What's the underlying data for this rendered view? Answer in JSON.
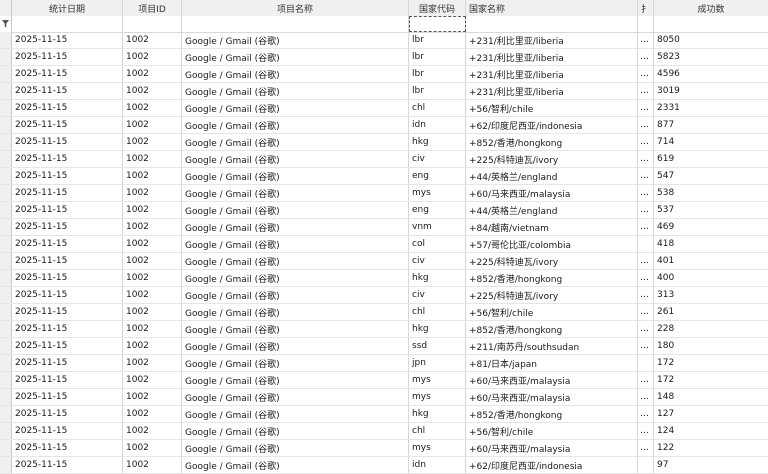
{
  "columns": [
    "统计日期",
    "项目ID",
    "项目名称",
    "国家代码",
    "国家名称",
    "扌",
    "成功数"
  ],
  "filter_icon": "funnel-icon",
  "rows": [
    [
      "2025-11-15",
      "1002",
      "Google / Gmail (谷歌)",
      "lbr",
      "+231/利比里亚/liberia",
      "…",
      "8050"
    ],
    [
      "2025-11-15",
      "1002",
      "Google / Gmail (谷歌)",
      "lbr",
      "+231/利比里亚/liberia",
      "…",
      "5823"
    ],
    [
      "2025-11-15",
      "1002",
      "Google / Gmail (谷歌)",
      "lbr",
      "+231/利比里亚/liberia",
      "…",
      "4596"
    ],
    [
      "2025-11-15",
      "1002",
      "Google / Gmail (谷歌)",
      "lbr",
      "+231/利比里亚/liberia",
      "…",
      "3019"
    ],
    [
      "2025-11-15",
      "1002",
      "Google / Gmail (谷歌)",
      "chl",
      "+56/智利/chile",
      "…",
      "2331"
    ],
    [
      "2025-11-15",
      "1002",
      "Google / Gmail (谷歌)",
      "idn",
      "+62/印度尼西亚/indonesia",
      "…",
      "877"
    ],
    [
      "2025-11-15",
      "1002",
      "Google / Gmail (谷歌)",
      "hkg",
      "+852/香港/hongkong",
      "…",
      "714"
    ],
    [
      "2025-11-15",
      "1002",
      "Google / Gmail (谷歌)",
      "civ",
      "+225/科特迪瓦/ivory",
      "…",
      "619"
    ],
    [
      "2025-11-15",
      "1002",
      "Google / Gmail (谷歌)",
      "eng",
      "+44/英格兰/england",
      "…",
      "547"
    ],
    [
      "2025-11-15",
      "1002",
      "Google / Gmail (谷歌)",
      "mys",
      "+60/马来西亚/malaysia",
      "…",
      "538"
    ],
    [
      "2025-11-15",
      "1002",
      "Google / Gmail (谷歌)",
      "eng",
      "+44/英格兰/england",
      "…",
      "537"
    ],
    [
      "2025-11-15",
      "1002",
      "Google / Gmail (谷歌)",
      "vnm",
      "+84/越南/vietnam",
      "…",
      "469"
    ],
    [
      "2025-11-15",
      "1002",
      "Google / Gmail (谷歌)",
      "col",
      "+57/哥伦比亚/colombia",
      "",
      "418"
    ],
    [
      "2025-11-15",
      "1002",
      "Google / Gmail (谷歌)",
      "civ",
      "+225/科特迪瓦/ivory",
      "…",
      "401"
    ],
    [
      "2025-11-15",
      "1002",
      "Google / Gmail (谷歌)",
      "hkg",
      "+852/香港/hongkong",
      "…",
      "400"
    ],
    [
      "2025-11-15",
      "1002",
      "Google / Gmail (谷歌)",
      "civ",
      "+225/科特迪瓦/ivory",
      "…",
      "313"
    ],
    [
      "2025-11-15",
      "1002",
      "Google / Gmail (谷歌)",
      "chl",
      "+56/智利/chile",
      "…",
      "261"
    ],
    [
      "2025-11-15",
      "1002",
      "Google / Gmail (谷歌)",
      "hkg",
      "+852/香港/hongkong",
      "…",
      "228"
    ],
    [
      "2025-11-15",
      "1002",
      "Google / Gmail (谷歌)",
      "ssd",
      "+211/南苏丹/southsudan",
      "…",
      "180"
    ],
    [
      "2025-11-15",
      "1002",
      "Google / Gmail (谷歌)",
      "jpn",
      "+81/日本/japan",
      "",
      "172"
    ],
    [
      "2025-11-15",
      "1002",
      "Google / Gmail (谷歌)",
      "mys",
      "+60/马来西亚/malaysia",
      "…",
      "172"
    ],
    [
      "2025-11-15",
      "1002",
      "Google / Gmail (谷歌)",
      "mys",
      "+60/马来西亚/malaysia",
      "…",
      "148"
    ],
    [
      "2025-11-15",
      "1002",
      "Google / Gmail (谷歌)",
      "hkg",
      "+852/香港/hongkong",
      "…",
      "127"
    ],
    [
      "2025-11-15",
      "1002",
      "Google / Gmail (谷歌)",
      "chl",
      "+56/智利/chile",
      "…",
      "124"
    ],
    [
      "2025-11-15",
      "1002",
      "Google / Gmail (谷歌)",
      "mys",
      "+60/马来西亚/malaysia",
      "…",
      "122"
    ],
    [
      "2025-11-15",
      "1002",
      "Google / Gmail (谷歌)",
      "idn",
      "+62/印度尼西亚/indonesia",
      "",
      "97"
    ]
  ]
}
